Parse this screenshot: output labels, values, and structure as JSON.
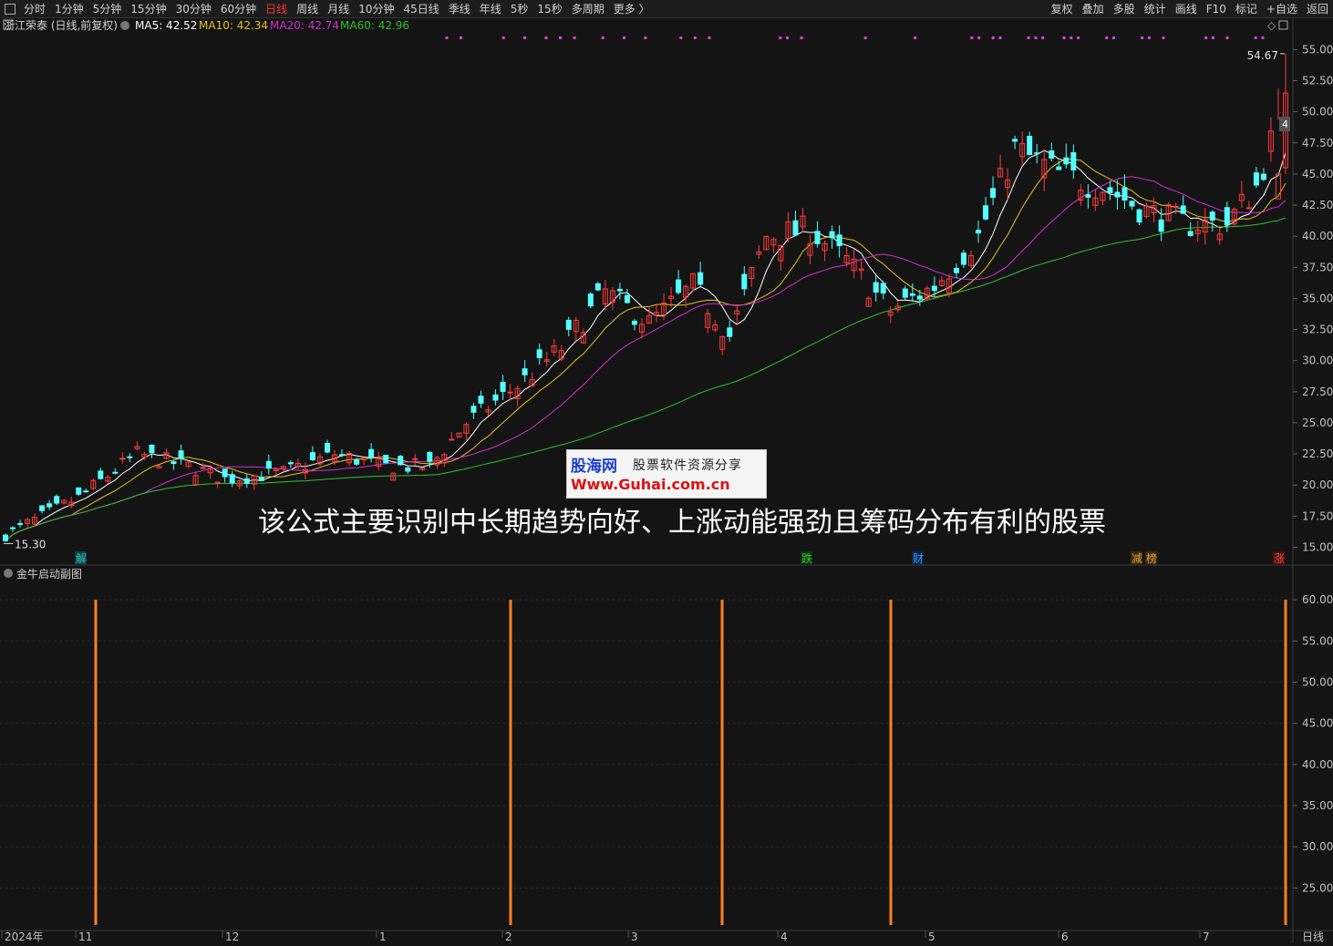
{
  "toolbar": {
    "periods": [
      "分时",
      "1分钟",
      "5分钟",
      "15分钟",
      "30分钟",
      "60分钟",
      "日线",
      "周线",
      "月线",
      "10分钟",
      "45日线",
      "季线",
      "年线",
      "5秒",
      "15秒",
      "多周期",
      "更多 〉"
    ],
    "active_period": "日线",
    "right_items": [
      "复权",
      "叠加",
      "多股",
      "统计",
      "画线",
      "F10",
      "标记",
      "+自选",
      "返回"
    ]
  },
  "main_chart": {
    "title": "浙江荣泰 (日线,前复权)",
    "ma": [
      {
        "label": "MA5: 42.52",
        "color": "#ffffff"
      },
      {
        "label": "MA10: 42.34",
        "color": "#e8c320"
      },
      {
        "label": "MA20: 42.74",
        "color": "#d030d0"
      },
      {
        "label": "MA60: 42.96",
        "color": "#30c030"
      }
    ],
    "y_labels": [
      "55.00",
      "52.50",
      "50.00",
      "47.50",
      "45.00",
      "42.50",
      "40.00",
      "37.50",
      "35.00",
      "32.50",
      "30.00",
      "27.50",
      "25.00",
      "22.50",
      "20.00",
      "17.50",
      "15.00"
    ],
    "ylim": [
      14.3,
      56.2
    ],
    "high_label": "54.67",
    "low_label": "15.30",
    "last_marker": "4",
    "event_markers": [
      {
        "text": "解",
        "color": "#30c0c0",
        "bg": "#104040"
      },
      {
        "text": "跌",
        "color": "#30d030",
        "bg": "#103010"
      },
      {
        "text": "财",
        "color": "#30a0ff",
        "bg": "#102040"
      },
      {
        "text": "减",
        "color": "#e0a040",
        "bg": "#3a2a10"
      },
      {
        "text": "榜",
        "color": "#e0a040",
        "bg": "#3a2a10"
      },
      {
        "text": "涨",
        "color": "#ff4040",
        "bg": "#401010"
      }
    ],
    "up_color": "#ff3c3c",
    "down_color": "#54ffff"
  },
  "sub_chart": {
    "title": "金牛启动副图",
    "y_labels": [
      "60.00",
      "55.00",
      "50.00",
      "45.00",
      "40.00",
      "35.00",
      "30.00",
      "25.00"
    ],
    "bar_color": "#ff7f1e"
  },
  "x_axis": {
    "labels": [
      "2024年",
      "11",
      "12",
      "1",
      "2",
      "3",
      "4",
      "5",
      "6",
      "7"
    ],
    "period_label": "日线"
  },
  "watermark": {
    "brand": "股海网",
    "slogan": "股票软件资源分享",
    "url": "Www.Guhai.com.cn"
  },
  "caption": "该公式主要识别中长期趋势向好、上涨动能强劲且筹码分布有利的股票"
}
